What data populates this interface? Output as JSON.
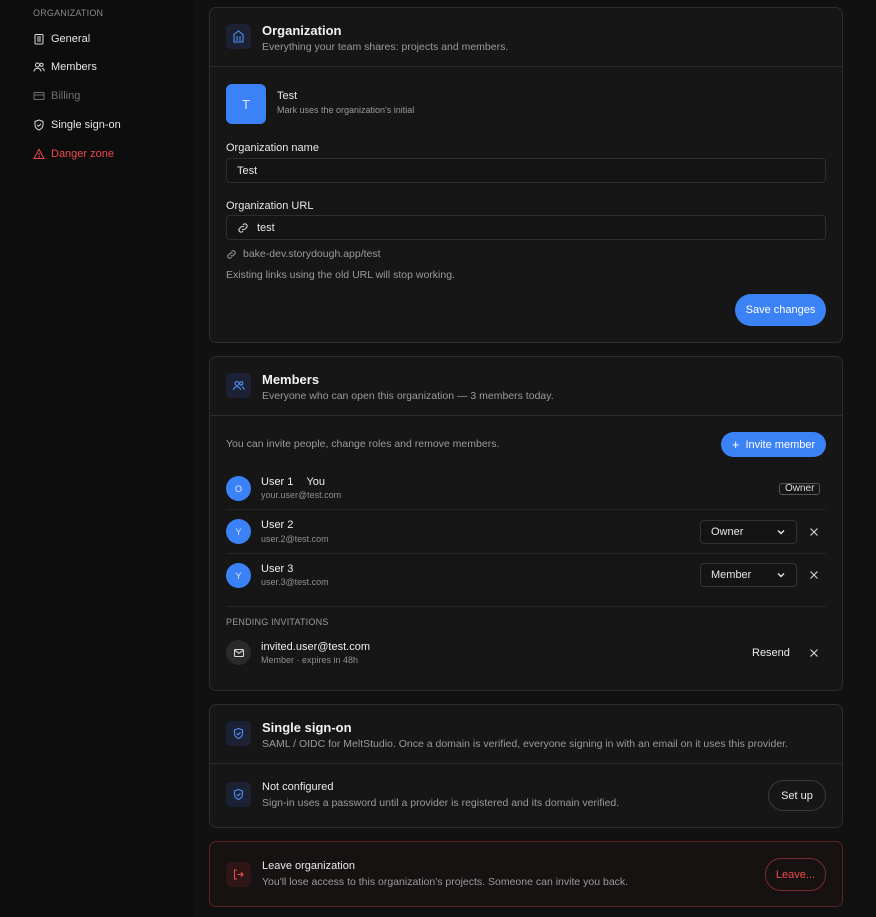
{
  "sidebar": {
    "section": "ORGANIZATION",
    "items": [
      {
        "label": "General",
        "icon": "building-icon"
      },
      {
        "label": "Members",
        "icon": "users-icon"
      },
      {
        "label": "Billing",
        "icon": "card-icon"
      },
      {
        "label": "Single sign-on",
        "icon": "shield-icon"
      },
      {
        "label": "Danger zone",
        "icon": "warning-icon"
      }
    ]
  },
  "org": {
    "title": "Organization",
    "subtitle": "Everything your team shares: projects and members.",
    "mark_initial": "T",
    "mark_name": "Test",
    "mark_desc": "Mark uses the organization's initial",
    "name_label": "Organization name",
    "name_value": "Test",
    "url_label": "Organization URL",
    "url_value": "test",
    "url_full": "bake-dev.storydough.app/test",
    "url_warning": "Existing links using the old URL will stop working.",
    "save": "Save changes"
  },
  "members": {
    "title": "Members",
    "subtitle": "Everyone who can open this organization — 3 members today.",
    "intro": "You can invite people, change roles and remove members.",
    "invite": "Invite member",
    "list": [
      {
        "initial": "O",
        "name": "User 1",
        "you": "You",
        "email": "your.user@test.com",
        "role": "Owner"
      },
      {
        "initial": "Y",
        "name": "User 2",
        "email": "user.2@test.com",
        "role": "Owner"
      },
      {
        "initial": "Y",
        "name": "User 3",
        "email": "user.3@test.com",
        "role": "Member"
      }
    ],
    "pending_label": "PENDING INVITATIONS",
    "pending": {
      "email": "invited.user@test.com",
      "meta": "Member · expires in 48h",
      "resend": "Resend"
    }
  },
  "sso": {
    "title": "Single sign-on",
    "subtitle": "SAML / OIDC for MeltStudio. Once a domain is verified, everyone signing in with an email on it uses this provider.",
    "status_title": "Not configured",
    "status_desc": "Sign-in uses a password until a provider is registered and its domain verified.",
    "setup": "Set up"
  },
  "leave": {
    "title": "Leave organization",
    "desc": "You'll lose access to this organization's projects. Someone can invite you back.",
    "button": "Leave..."
  },
  "colors": {
    "accent": "#3b82f6",
    "danger": "#ef4b4b",
    "background": "#111111",
    "card": "#161616"
  }
}
